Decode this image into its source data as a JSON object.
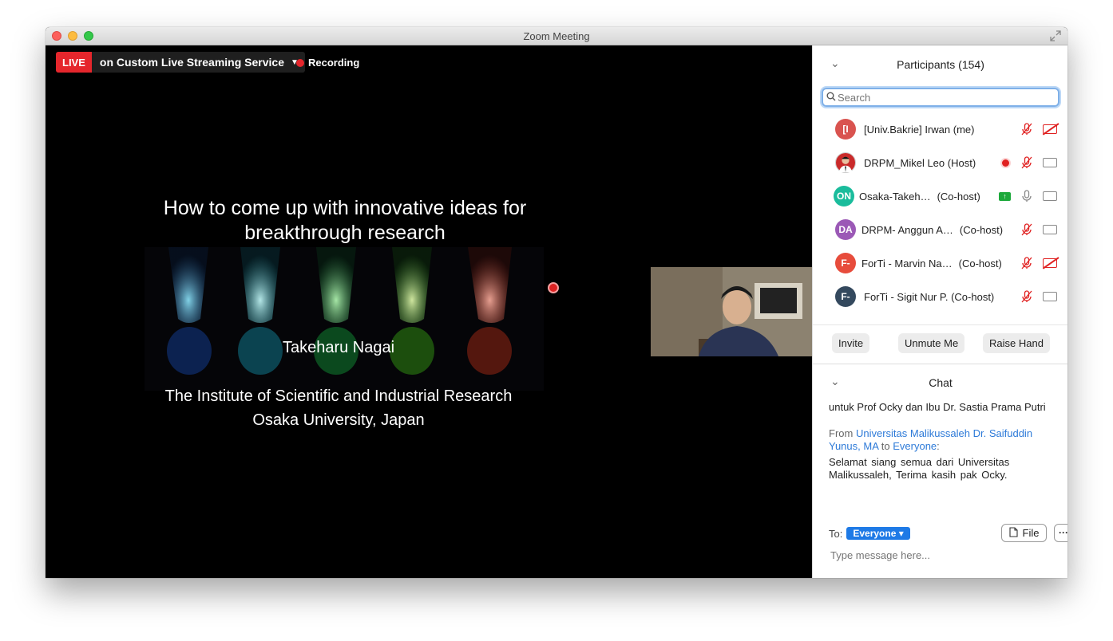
{
  "window": {
    "title": "Zoom Meeting"
  },
  "video": {
    "live_label": "LIVE",
    "live_service": "on Custom Live Streaming Service",
    "recording_label": "Recording",
    "slide": {
      "title": "How to come up with innovative ideas for breakthrough research",
      "speaker": "Takeharu Nagai",
      "affiliation_line1": "The Institute of Scientific and Industrial Research",
      "affiliation_line2": "Osaka University, Japan"
    }
  },
  "participants": {
    "title": "Participants (154)",
    "search_placeholder": "Search",
    "list": [
      {
        "initials": "[I",
        "color": "#d9534f",
        "name": "[Univ.Bakrie] Irwan (me)",
        "role": "",
        "mic": "off",
        "cam": "off"
      },
      {
        "initials": "",
        "color": "#c0392b",
        "name": "DRPM_Mikel Leo (Host)",
        "role": "",
        "mic": "off",
        "cam": "on",
        "recording": true
      },
      {
        "initials": "ON",
        "color": "#1abc9c",
        "name": "Osaka-Takeh…",
        "role": "(Co-host)",
        "mic": "on",
        "cam": "on",
        "sharing": true
      },
      {
        "initials": "DA",
        "color": "#9b59b6",
        "name": "DRPM- Anggun A…",
        "role": "(Co-host)",
        "mic": "off",
        "cam": "on"
      },
      {
        "initials": "F-",
        "color": "#e74c3c",
        "name": "ForTi - Marvin Na…",
        "role": "(Co-host)",
        "mic": "off",
        "cam": "off"
      },
      {
        "initials": "F-",
        "color": "#34495e",
        "name": "ForTi - Sigit Nur P. (Co-host)",
        "role": "",
        "mic": "off",
        "cam": "on"
      }
    ],
    "buttons": {
      "invite": "Invite",
      "unmute": "Unmute Me",
      "raise": "Raise Hand"
    }
  },
  "chat": {
    "title": "Chat",
    "msg1": "untuk Prof Ocky dan Ibu Dr. Sastia Prama Putri",
    "from_prefix": "From ",
    "from_name": "Universitas Malikussaleh Dr. Saifuddin Yunus, MA",
    "from_to": " to ",
    "from_target": "Everyone",
    "from_colon": ":",
    "msg2": "Selamat siang  semua  dari  Universitas Malikussaleh, Terima  kasih  pak Ocky.",
    "to_label": "To:",
    "to_value": "Everyone",
    "file_label": "File",
    "more_label": "···",
    "input_placeholder": "Type message here..."
  },
  "colors": {
    "live": "#e5262c",
    "accent": "#1e7ae6",
    "mic_off": "#e02020"
  }
}
